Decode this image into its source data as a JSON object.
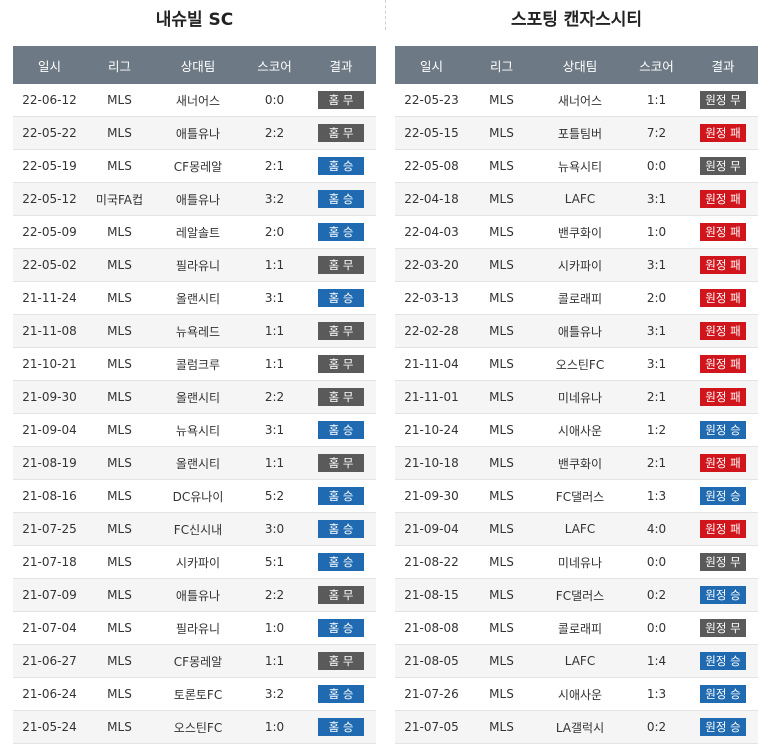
{
  "colors": {
    "header_bg": "#6d7a85",
    "win": "#1f6ab0",
    "draw": "#5a5a5a",
    "loss": "#d0161c"
  },
  "left": {
    "title": "내슈빌 SC",
    "headers": [
      "일시",
      "리그",
      "상대팀",
      "스코어",
      "결과"
    ],
    "rows": [
      {
        "date": "22-06-12",
        "league": "MLS",
        "opponent": "새너어스",
        "score": "0:0",
        "result": "홈 무",
        "type": "home-draw"
      },
      {
        "date": "22-05-22",
        "league": "MLS",
        "opponent": "애틀유나",
        "score": "2:2",
        "result": "홈 무",
        "type": "home-draw"
      },
      {
        "date": "22-05-19",
        "league": "MLS",
        "opponent": "CF몽레알",
        "score": "2:1",
        "result": "홈 승",
        "type": "home-win"
      },
      {
        "date": "22-05-12",
        "league": "미국FA컵",
        "opponent": "애틀유나",
        "score": "3:2",
        "result": "홈 승",
        "type": "home-win"
      },
      {
        "date": "22-05-09",
        "league": "MLS",
        "opponent": "레알솔트",
        "score": "2:0",
        "result": "홈 승",
        "type": "home-win"
      },
      {
        "date": "22-05-02",
        "league": "MLS",
        "opponent": "필라유니",
        "score": "1:1",
        "result": "홈 무",
        "type": "home-draw"
      },
      {
        "date": "21-11-24",
        "league": "MLS",
        "opponent": "올랜시티",
        "score": "3:1",
        "result": "홈 승",
        "type": "home-win"
      },
      {
        "date": "21-11-08",
        "league": "MLS",
        "opponent": "뉴욕레드",
        "score": "1:1",
        "result": "홈 무",
        "type": "home-draw"
      },
      {
        "date": "21-10-21",
        "league": "MLS",
        "opponent": "콜럼크루",
        "score": "1:1",
        "result": "홈 무",
        "type": "home-draw"
      },
      {
        "date": "21-09-30",
        "league": "MLS",
        "opponent": "올랜시티",
        "score": "2:2",
        "result": "홈 무",
        "type": "home-draw"
      },
      {
        "date": "21-09-04",
        "league": "MLS",
        "opponent": "뉴욕시티",
        "score": "3:1",
        "result": "홈 승",
        "type": "home-win"
      },
      {
        "date": "21-08-19",
        "league": "MLS",
        "opponent": "올랜시티",
        "score": "1:1",
        "result": "홈 무",
        "type": "home-draw"
      },
      {
        "date": "21-08-16",
        "league": "MLS",
        "opponent": "DC유나이",
        "score": "5:2",
        "result": "홈 승",
        "type": "home-win"
      },
      {
        "date": "21-07-25",
        "league": "MLS",
        "opponent": "FC신시내",
        "score": "3:0",
        "result": "홈 승",
        "type": "home-win"
      },
      {
        "date": "21-07-18",
        "league": "MLS",
        "opponent": "시카파이",
        "score": "5:1",
        "result": "홈 승",
        "type": "home-win"
      },
      {
        "date": "21-07-09",
        "league": "MLS",
        "opponent": "애틀유나",
        "score": "2:2",
        "result": "홈 무",
        "type": "home-draw"
      },
      {
        "date": "21-07-04",
        "league": "MLS",
        "opponent": "필라유니",
        "score": "1:0",
        "result": "홈 승",
        "type": "home-win"
      },
      {
        "date": "21-06-27",
        "league": "MLS",
        "opponent": "CF몽레알",
        "score": "1:1",
        "result": "홈 무",
        "type": "home-draw"
      },
      {
        "date": "21-06-24",
        "league": "MLS",
        "opponent": "토론토FC",
        "score": "3:2",
        "result": "홈 승",
        "type": "home-win"
      },
      {
        "date": "21-05-24",
        "league": "MLS",
        "opponent": "오스틴FC",
        "score": "1:0",
        "result": "홈 승",
        "type": "home-win"
      }
    ]
  },
  "right": {
    "title": "스포팅 캔자스시티",
    "headers": [
      "일시",
      "리그",
      "상대팀",
      "스코어",
      "결과"
    ],
    "rows": [
      {
        "date": "22-05-23",
        "league": "MLS",
        "opponent": "새너어스",
        "score": "1:1",
        "result": "원정 무",
        "type": "away-draw"
      },
      {
        "date": "22-05-15",
        "league": "MLS",
        "opponent": "포틀팀버",
        "score": "7:2",
        "result": "원정 패",
        "type": "away-loss"
      },
      {
        "date": "22-05-08",
        "league": "MLS",
        "opponent": "뉴욕시티",
        "score": "0:0",
        "result": "원정 무",
        "type": "away-draw"
      },
      {
        "date": "22-04-18",
        "league": "MLS",
        "opponent": "LAFC",
        "score": "3:1",
        "result": "원정 패",
        "type": "away-loss"
      },
      {
        "date": "22-04-03",
        "league": "MLS",
        "opponent": "밴쿠화이",
        "score": "1:0",
        "result": "원정 패",
        "type": "away-loss"
      },
      {
        "date": "22-03-20",
        "league": "MLS",
        "opponent": "시카파이",
        "score": "3:1",
        "result": "원정 패",
        "type": "away-loss"
      },
      {
        "date": "22-03-13",
        "league": "MLS",
        "opponent": "콜로래피",
        "score": "2:0",
        "result": "원정 패",
        "type": "away-loss"
      },
      {
        "date": "22-02-28",
        "league": "MLS",
        "opponent": "애틀유나",
        "score": "3:1",
        "result": "원정 패",
        "type": "away-loss"
      },
      {
        "date": "21-11-04",
        "league": "MLS",
        "opponent": "오스틴FC",
        "score": "3:1",
        "result": "원정 패",
        "type": "away-loss"
      },
      {
        "date": "21-11-01",
        "league": "MLS",
        "opponent": "미네유나",
        "score": "2:1",
        "result": "원정 패",
        "type": "away-loss"
      },
      {
        "date": "21-10-24",
        "league": "MLS",
        "opponent": "시애사운",
        "score": "1:2",
        "result": "원정 승",
        "type": "away-win"
      },
      {
        "date": "21-10-18",
        "league": "MLS",
        "opponent": "밴쿠화이",
        "score": "2:1",
        "result": "원정 패",
        "type": "away-loss"
      },
      {
        "date": "21-09-30",
        "league": "MLS",
        "opponent": "FC댈러스",
        "score": "1:3",
        "result": "원정 승",
        "type": "away-win"
      },
      {
        "date": "21-09-04",
        "league": "MLS",
        "opponent": "LAFC",
        "score": "4:0",
        "result": "원정 패",
        "type": "away-loss"
      },
      {
        "date": "21-08-22",
        "league": "MLS",
        "opponent": "미네유나",
        "score": "0:0",
        "result": "원정 무",
        "type": "away-draw"
      },
      {
        "date": "21-08-15",
        "league": "MLS",
        "opponent": "FC댈러스",
        "score": "0:2",
        "result": "원정 승",
        "type": "away-win"
      },
      {
        "date": "21-08-08",
        "league": "MLS",
        "opponent": "콜로래피",
        "score": "0:0",
        "result": "원정 무",
        "type": "away-draw"
      },
      {
        "date": "21-08-05",
        "league": "MLS",
        "opponent": "LAFC",
        "score": "1:4",
        "result": "원정 승",
        "type": "away-win"
      },
      {
        "date": "21-07-26",
        "league": "MLS",
        "opponent": "시애사운",
        "score": "1:3",
        "result": "원정 승",
        "type": "away-win"
      },
      {
        "date": "21-07-05",
        "league": "MLS",
        "opponent": "LA갤럭시",
        "score": "0:2",
        "result": "원정 승",
        "type": "away-win"
      }
    ]
  }
}
